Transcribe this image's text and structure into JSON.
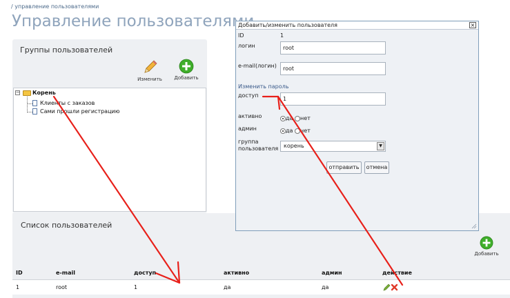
{
  "breadcrumb": "/ управление пользователями",
  "page_title": "Управление пользователями",
  "groups": {
    "title": "Группы пользователей",
    "edit_label": "Изменить",
    "add_label": "Добавить",
    "tree": {
      "root": "Корень",
      "children": [
        "Клиенты с заказов",
        "Сами прошли регистрацию"
      ]
    }
  },
  "users": {
    "title": "Список пользователей",
    "add_label": "Добавить",
    "columns": [
      "ID",
      "e-mail",
      "доступ",
      "активно",
      "админ",
      "действие"
    ],
    "rows": [
      {
        "id": "1",
        "email": "root",
        "access": "1",
        "active": "да",
        "admin": "да"
      }
    ]
  },
  "modal": {
    "title": "Добавить/изменить пользователя",
    "id_label": "ID",
    "id_value": "1",
    "login_label": "логин",
    "login_value": "root",
    "email_label": "e-mail(логин)",
    "email_value": "root",
    "change_password": "Изменить пароль",
    "access_label": "доступ",
    "access_value": "1",
    "active_label": "активно",
    "admin_label": "админ",
    "yes": "да",
    "no": "нет",
    "group_label_1": "группа",
    "group_label_2": "пользователя",
    "group_value": "корень",
    "submit_label": "отправить",
    "cancel_label": "отмена",
    "close_glyph": "×"
  },
  "colors": {
    "title": "#8fa4bc",
    "panel_bg": "#eef0f3",
    "annotation": "#e8201a",
    "add_icon": "#3fae2a"
  }
}
